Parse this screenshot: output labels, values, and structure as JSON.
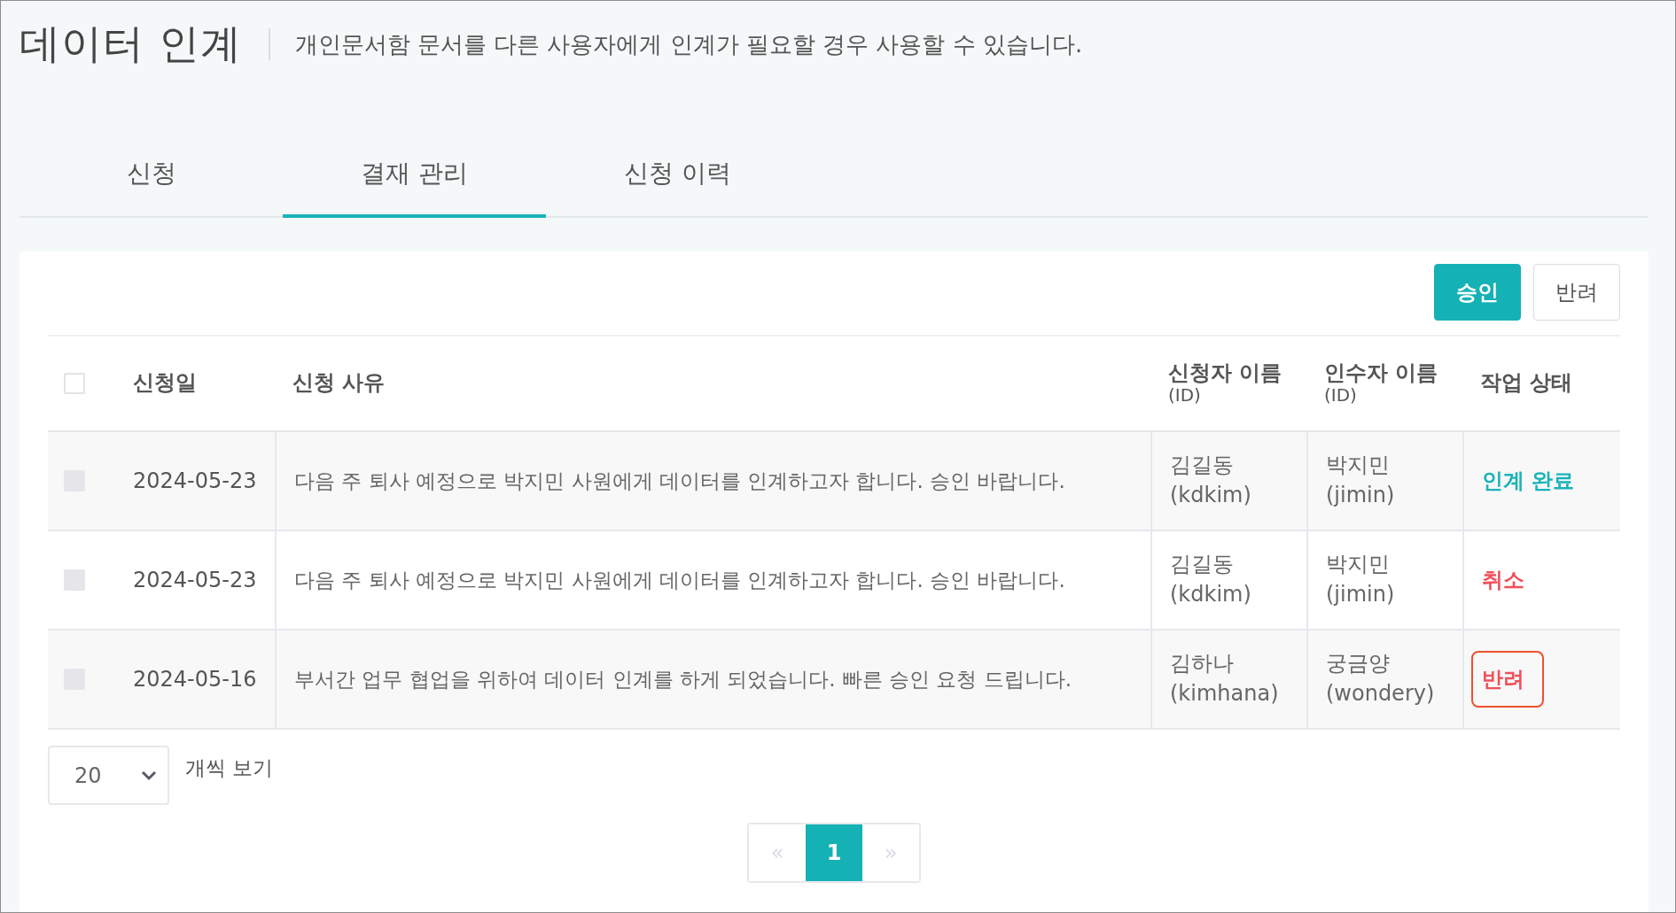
{
  "header": {
    "title": "데이터 인계",
    "description": "개인문서함 문서를 다른 사용자에게 인계가 필요할 경우 사용할 수 있습니다."
  },
  "tabs": [
    {
      "label": "신청",
      "selected": false
    },
    {
      "label": "결재 관리",
      "selected": true
    },
    {
      "label": "신청 이력",
      "selected": false
    }
  ],
  "actions": [
    {
      "label": "승인",
      "kind": "primary"
    },
    {
      "label": "반려",
      "kind": "secondary"
    }
  ],
  "table": {
    "select_all": {
      "checked": false
    },
    "columns": [
      {
        "label": "신청일"
      },
      {
        "label": "신청 사유"
      },
      {
        "label": "신청자 이름",
        "sub": "(ID)"
      },
      {
        "label": "인수자 이름",
        "sub": "(ID)"
      },
      {
        "label": "작업 상태"
      }
    ],
    "rows": [
      {
        "checked": false,
        "disabled": true,
        "date": "2024-05-23",
        "reason": "다음 주 퇴사 예정으로 박지민 사원에게 데이터를 인계하고자 합니다. 승인 바랍니다.",
        "applicant": "김길동",
        "applicant_id": "(kdkim)",
        "receiver": "박지민",
        "receiver_id": "(jimin)",
        "status": "인계 완료",
        "kind": "done",
        "highlighted": false
      },
      {
        "checked": false,
        "disabled": true,
        "date": "2024-05-23",
        "reason": "다음 주 퇴사 예정으로 박지민 사원에게 데이터를 인계하고자 합니다. 승인 바랍니다.",
        "applicant": "김길동",
        "applicant_id": "(kdkim)",
        "receiver": "박지민",
        "receiver_id": "(jimin)",
        "status": "취소",
        "kind": "cancelled",
        "highlighted": false
      },
      {
        "checked": false,
        "disabled": true,
        "date": "2024-05-16",
        "reason": "부서간 업무 협업을 위하여 데이터 인계를 하게 되었습니다. 빠른 승인 요청 드립니다.",
        "applicant": "김하나",
        "applicant_id": "(kimhana)",
        "receiver": "궁금양",
        "receiver_id": "(wondery)",
        "status": "반려",
        "kind": "rejected",
        "highlighted": true
      }
    ]
  },
  "page_size": {
    "value": "20",
    "label": "개씩 보기"
  },
  "pagination": {
    "prev": "«",
    "next": "»",
    "pages": [
      {
        "label": "1",
        "selected": true
      }
    ]
  }
}
